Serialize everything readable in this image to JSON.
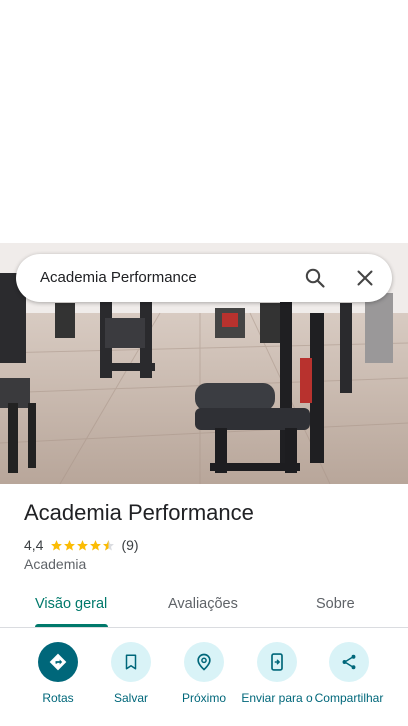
{
  "search": {
    "query": "Academia Performance"
  },
  "place": {
    "name": "Academia Performance",
    "rating": "4,4",
    "review_count": "(9)",
    "stars": 4.5,
    "category": "Academia"
  },
  "tabs": [
    {
      "label": "Visão geral",
      "active": true
    },
    {
      "label": "Avaliações",
      "active": false
    },
    {
      "label": "Sobre",
      "active": false
    }
  ],
  "actions": [
    {
      "label": "Rotas",
      "icon": "directions-icon"
    },
    {
      "label": "Salvar",
      "icon": "bookmark-icon"
    },
    {
      "label": "Próximo",
      "icon": "nearby-icon"
    },
    {
      "label": "Enviar para o",
      "icon": "send-to-phone-icon"
    },
    {
      "label": "Compartilhar",
      "icon": "share-icon"
    }
  ],
  "colors": {
    "accent": "#00796b",
    "action_bg": "#d9f3f7",
    "primary_action": "#00677a",
    "star": "#fbbc04"
  }
}
